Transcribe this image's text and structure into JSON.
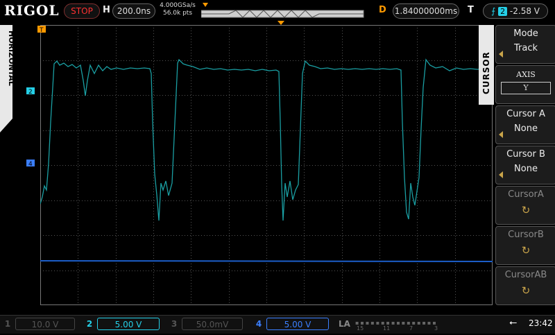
{
  "header": {
    "logo": "RIGOL",
    "run_state": "STOP",
    "h_label": "H",
    "timebase": "200.0ns",
    "sample_rate": "4.000GSa/s",
    "mem_depth": "56.0k pts",
    "d_label": "D",
    "delay": "1.84000000ms",
    "t_label": "T",
    "trigger_channel": "2",
    "trigger_level": "-2.58 V"
  },
  "left_tab": {
    "label": "HORIZONTAL"
  },
  "markers": {
    "trigger": "T",
    "ch2": "2",
    "ch4": "4"
  },
  "menu": {
    "title": "CURSOR",
    "items": [
      {
        "label": "Mode",
        "value": "Track"
      },
      {
        "label": "AXIS",
        "value": "Y"
      },
      {
        "label": "Cursor A",
        "value": "None"
      },
      {
        "label": "Cursor B",
        "value": "None"
      },
      {
        "label": "CursorA",
        "value": "↻"
      },
      {
        "label": "CursorB",
        "value": "↻"
      },
      {
        "label": "CursorAB",
        "value": "↻"
      }
    ]
  },
  "channels": [
    {
      "num": "1",
      "scale": "10.0 V",
      "color": "#555555"
    },
    {
      "num": "2",
      "scale": "5.00 V",
      "color": "#25d0e8"
    },
    {
      "num": "3",
      "scale": "50.0mV",
      "color": "#555555"
    },
    {
      "num": "4",
      "scale": "5.00 V",
      "color": "#3b7fff"
    }
  ],
  "la": {
    "label": "LA",
    "ticks": [
      "15",
      "11",
      "7",
      "3"
    ]
  },
  "status": {
    "time": "23:42"
  },
  "colors": {
    "ch2_trace": "#1a9fa3",
    "ch4_trace": "#1c5ec9",
    "grid": "#6a6a6a",
    "accent": "#ff9a00"
  }
}
